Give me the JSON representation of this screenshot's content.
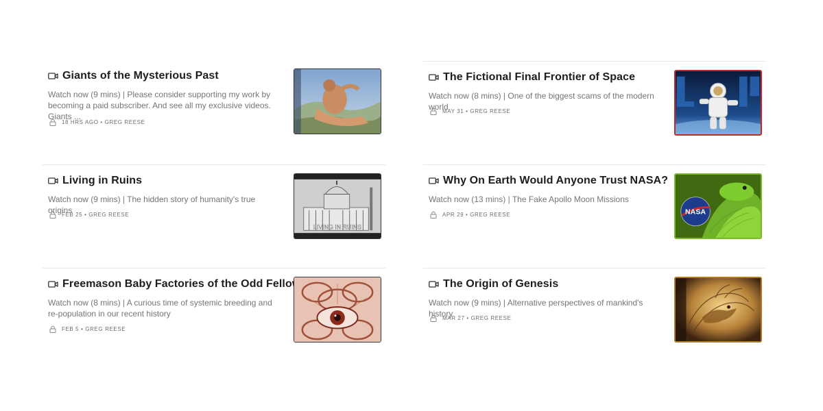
{
  "posts_left": [
    {
      "title": "Giants of the Mysterious Past",
      "description": "Watch now (9 mins) | Please consider supporting my work by becoming a paid subscriber. And see all my exclusive videos. Giants ...",
      "date": "18 HRS AGO",
      "author": "GREG REESE",
      "thumb_icon": "giant-figure-thumbnail"
    },
    {
      "title": "Living in Ruins",
      "description": "Watch now (9 mins) | The hidden story of humanity's true origins",
      "date": "FEB 25",
      "author": "GREG REESE",
      "thumb_icon": "domed-building-thumbnail",
      "thumb_caption": "LIVING IN RUINS"
    },
    {
      "title": "Freemason Baby Factories of the Odd Fellows",
      "description": "Watch now (8 mins) | A curious time of systemic breeding and re-population in our recent history",
      "date": "FEB 5",
      "author": "GREG REESE",
      "thumb_icon": "eye-in-chains-thumbnail"
    }
  ],
  "posts_right": [
    {
      "title": "The Fictional Final Frontier of Space",
      "description": "Watch now (8 mins) | One of the biggest scams of the modern world",
      "date": "MAY 31",
      "author": "GREG REESE",
      "thumb_icon": "astronaut-thumbnail"
    },
    {
      "title": "Why On Earth Would Anyone Trust NASA?",
      "description": "Watch now (13 mins) | The Fake Apollo Moon Missions",
      "date": "APR 29",
      "author": "GREG REESE",
      "thumb_icon": "nasa-snake-thumbnail",
      "thumb_caption": "NASA"
    },
    {
      "title": "The Origin of Genesis",
      "description": "Watch now (9 mins) | Alternative perspectives of mankind's history",
      "date": "MAR 27",
      "author": "GREG REESE",
      "thumb_icon": "golden-dragon-thumbnail"
    }
  ],
  "separator": "•",
  "colors": {
    "accent_red": "#d42a2a",
    "text_dark": "#1d1d1d",
    "text_muted": "#757575"
  }
}
